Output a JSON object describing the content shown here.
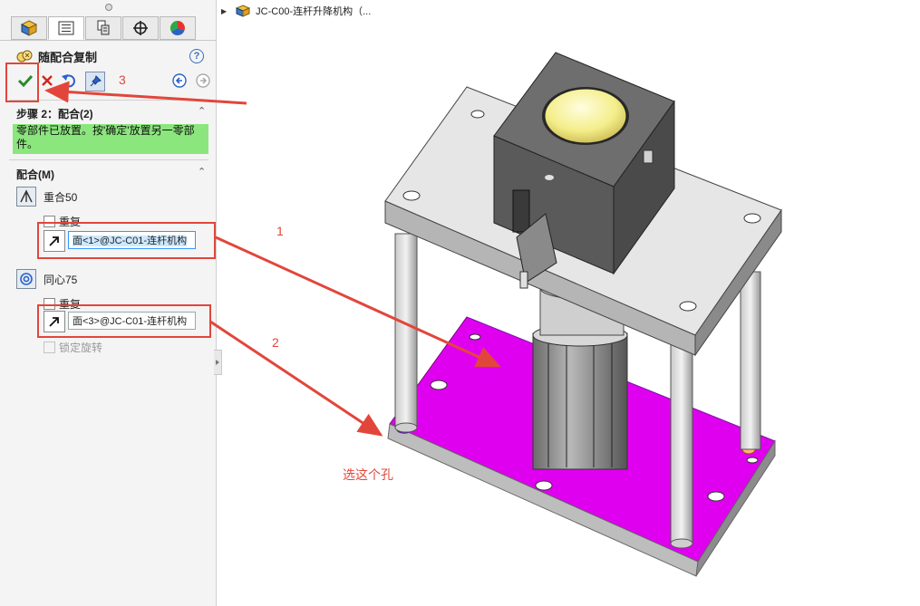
{
  "panel": {
    "title": "随配合复制",
    "help_label": "?",
    "tab_icons": [
      "feature-manager-icon",
      "property-manager-icon",
      "configuration-manager-icon",
      "dimxpert-icon",
      "display-manager-icon"
    ],
    "step": {
      "title": "步骤 2：配合(2)",
      "message": "零部件已放置。按'确定'放置另一零部件。"
    },
    "mates": {
      "title": "配合(M)",
      "items": [
        {
          "name": "重合50",
          "repeat_label": "重复",
          "face": "面<1>@JC-C01-连杆机构",
          "selected": true
        },
        {
          "name": "同心75",
          "repeat_label": "重复",
          "face": "面<3>@JC-C01-连杆机构",
          "selected": false
        }
      ],
      "lock_rotation_label": "锁定旋转"
    }
  },
  "tree": {
    "root_label": "JC-C00-连杆升降机构（..."
  },
  "annotations": {
    "label1": "1",
    "label2": "2",
    "label3": "3",
    "hint": "选这个孔"
  },
  "colors": {
    "highlight_face": "#e000f0",
    "annotation_red": "#e2463b",
    "message_bg": "#8be67d",
    "ok_green": "#2a8a2a"
  }
}
